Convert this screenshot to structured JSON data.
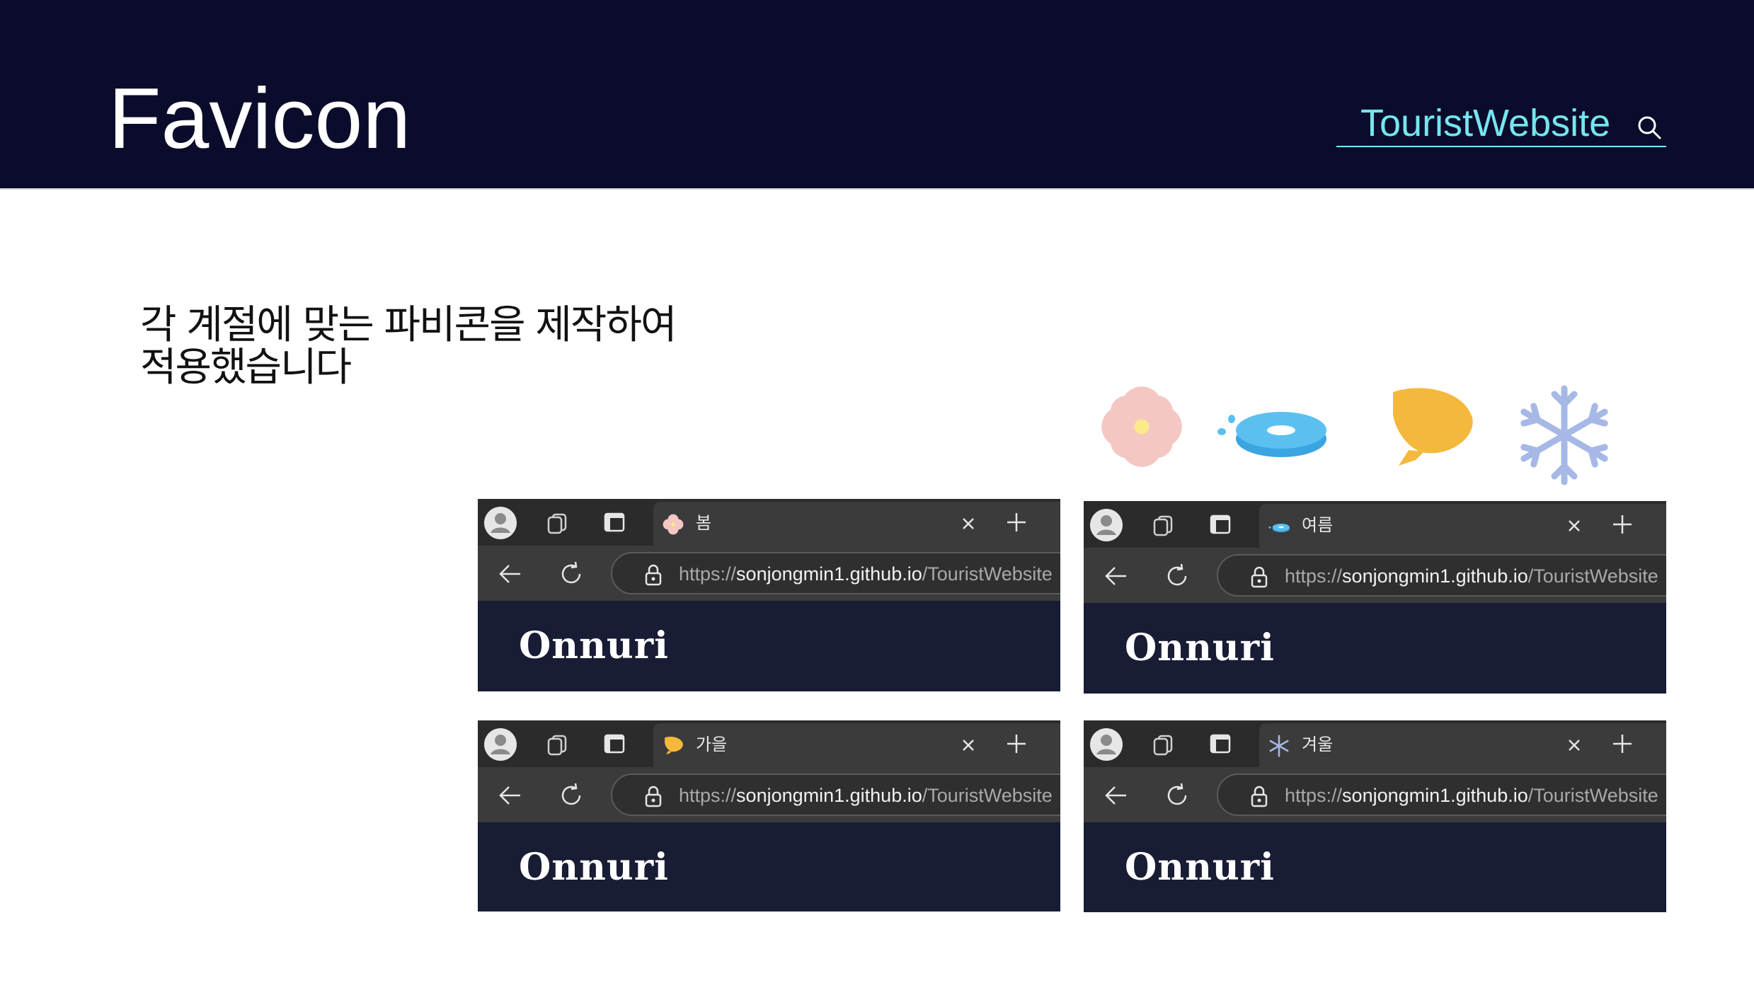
{
  "header": {
    "title": "Favicon",
    "brand": "TouristWebsite",
    "brand_icon": "search-icon"
  },
  "description": {
    "line1": "각 계절에 맞는 파비콘을 제작하여",
    "line2": "적용했습니다"
  },
  "season_icons": [
    {
      "name": "spring-flower-icon",
      "color": "#f4c7c3"
    },
    {
      "name": "summer-pool-float-icon",
      "color": "#5bc0f0"
    },
    {
      "name": "autumn-leaf-fan-icon",
      "color": "#f4b93c"
    },
    {
      "name": "winter-snowflake-icon",
      "color": "#a6b8e6"
    }
  ],
  "colors": {
    "header_bg": "#0b0c2b",
    "brand": "#74e6f0",
    "tabbar": "#2b2b2b",
    "toolbar": "#3b3b3b",
    "site_bg": "#181c34"
  },
  "browsers": [
    {
      "tab_label": "봄",
      "favicon": "spring-flower-icon",
      "url_scheme": "https://",
      "url_host": "sonjongmin1.github.io",
      "url_path": "/TouristWebsite",
      "site_logo": "Onnuri"
    },
    {
      "tab_label": "여름",
      "favicon": "summer-pool-float-icon",
      "url_scheme": "https://",
      "url_host": "sonjongmin1.github.io",
      "url_path": "/TouristWebsite",
      "site_logo": "Onnuri"
    },
    {
      "tab_label": "가을",
      "favicon": "autumn-leaf-fan-icon",
      "url_scheme": "https://",
      "url_host": "sonjongmin1.github.io",
      "url_path": "/TouristWebsite",
      "site_logo": "Onnuri"
    },
    {
      "tab_label": "겨울",
      "favicon": "winter-snowflake-icon",
      "url_scheme": "https://",
      "url_host": "sonjongmin1.github.io",
      "url_path": "/TouristWebsite",
      "site_logo": "Onnuri"
    }
  ]
}
